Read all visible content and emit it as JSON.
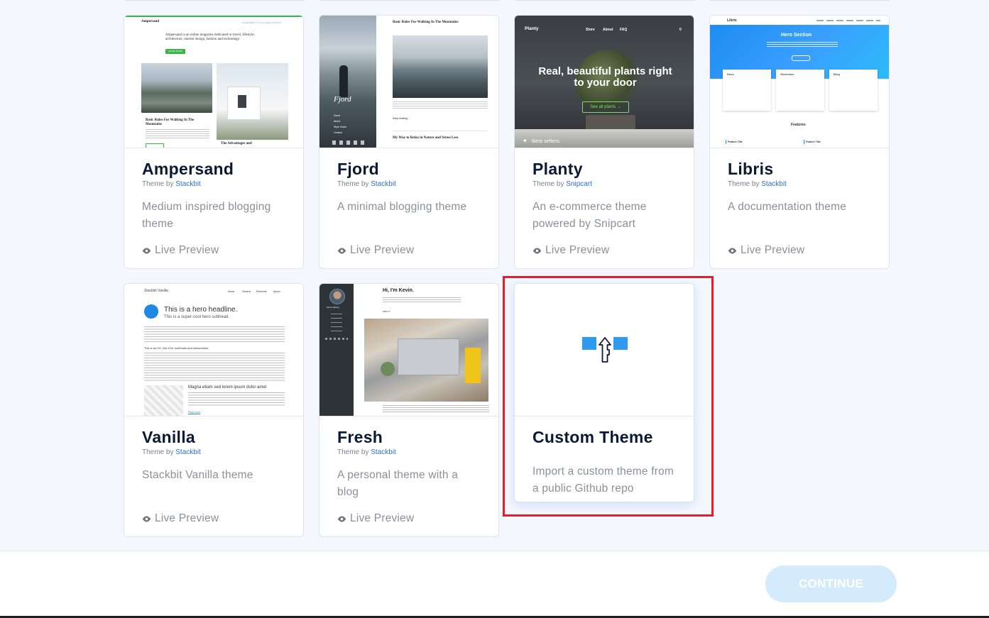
{
  "themes": [
    {
      "name": "Ampersand",
      "by_prefix": "Theme by",
      "author": "Stackbit",
      "description": "Medium inspired blogging theme",
      "preview": "Live Preview",
      "thumb": {
        "brand": "Ampersand",
        "nav": "HOME ABOUT STYLE GUIDE CONTACT",
        "intro": "Ampersand is an online magazine dedicated to travel, lifestyle, architecture, interior design, fashion and technology.",
        "cta": "LEARN MORE",
        "post1": "Basic Rules For Walking In The Mountains",
        "post2": "The Advantages and"
      }
    },
    {
      "name": "Fjord",
      "by_prefix": "Theme by",
      "author": "Stackbit",
      "description": "A minimal blogging theme",
      "preview": "Live Preview",
      "thumb": {
        "brand": "Fjord",
        "post1": "Basic Rules For Walking In The Mountains",
        "more": "Keep reading →",
        "post2": "My Way to Relax in Nature and Stress Less",
        "menu": [
          "Home",
          "About",
          "Style Guide",
          "Contact"
        ]
      }
    },
    {
      "name": "Planty",
      "by_prefix": "Theme by",
      "author": "Snipcart",
      "description": "An e-commerce theme powered by Snipcart",
      "preview": "Live Preview",
      "thumb": {
        "brand": "Planty",
        "nav": [
          "Store",
          "About",
          "FAQ"
        ],
        "cart": "0",
        "hero": "Real, beautiful plants right to your door",
        "cta": "See all plants →",
        "label": "Best sellers"
      }
    },
    {
      "name": "Libris",
      "by_prefix": "Theme by",
      "author": "Stackbit",
      "description": "A documentation theme",
      "preview": "Live Preview",
      "thumb": {
        "brand": "Libris",
        "hero": "Hero Section",
        "cards": [
          "Docs",
          "Showcase",
          "Blog"
        ],
        "features": "Features",
        "feature_item": "Feature Title"
      }
    },
    {
      "name": "Vanilla",
      "by_prefix": "Theme by",
      "author": "Stackbit",
      "description": "Stackbit Vanilla theme",
      "preview": "Live Preview",
      "thumb": {
        "brand": "Stackbit Vanilla",
        "nav": [
          "Home",
          "Generic",
          "Elements",
          "Ipsum"
        ],
        "headline": "This is a hero headline.",
        "subhead": "This is a super-cool hero subhead.",
        "section": "This is an H3. Use it for subheads and subsections.",
        "post": "Magna etiam sed lorem ipsum dolor amet",
        "more": "Read more"
      }
    },
    {
      "name": "Fresh",
      "by_prefix": "Theme by",
      "author": "Stackbit",
      "description": "A personal theme with a blog",
      "preview": "Live Preview",
      "thumb": {
        "hello": "Hi, I'm Kevin.",
        "person": "Kevin Harvey",
        "about": "ABOUT"
      }
    }
  ],
  "custom_theme": {
    "name": "Custom Theme",
    "description": "Import a custom theme from a public Github repo"
  },
  "footer": {
    "continue_label": "CONTINUE"
  },
  "colors": {
    "accent": "#2b6fd6",
    "highlight": "#e0202a",
    "continue_bg": "#d4ebfd",
    "title": "#0b1a33"
  }
}
